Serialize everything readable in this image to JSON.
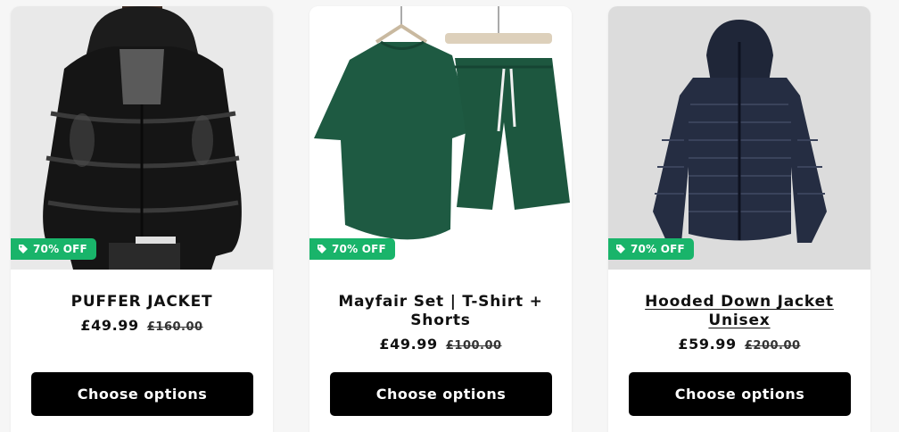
{
  "products": [
    {
      "badge": "70% OFF",
      "title": "PUFFER JACKET",
      "price": "£49.99",
      "compare_price": "£160.00",
      "button_label": "Choose options"
    },
    {
      "badge": "70% OFF",
      "title": "Mayfair Set | T-Shirt + Shorts",
      "price": "£49.99",
      "compare_price": "£100.00",
      "button_label": "Choose options"
    },
    {
      "badge": "70% OFF",
      "title": "Hooded Down Jacket Unisex",
      "price": "£59.99",
      "compare_price": "£200.00",
      "button_label": "Choose options"
    }
  ],
  "colors": {
    "badge_bg": "#19b46a",
    "button_bg": "#000000",
    "card_bg": "#ffffff",
    "page_bg": "#f6f6f6"
  },
  "icons": {
    "badge": "price-tag-icon"
  }
}
